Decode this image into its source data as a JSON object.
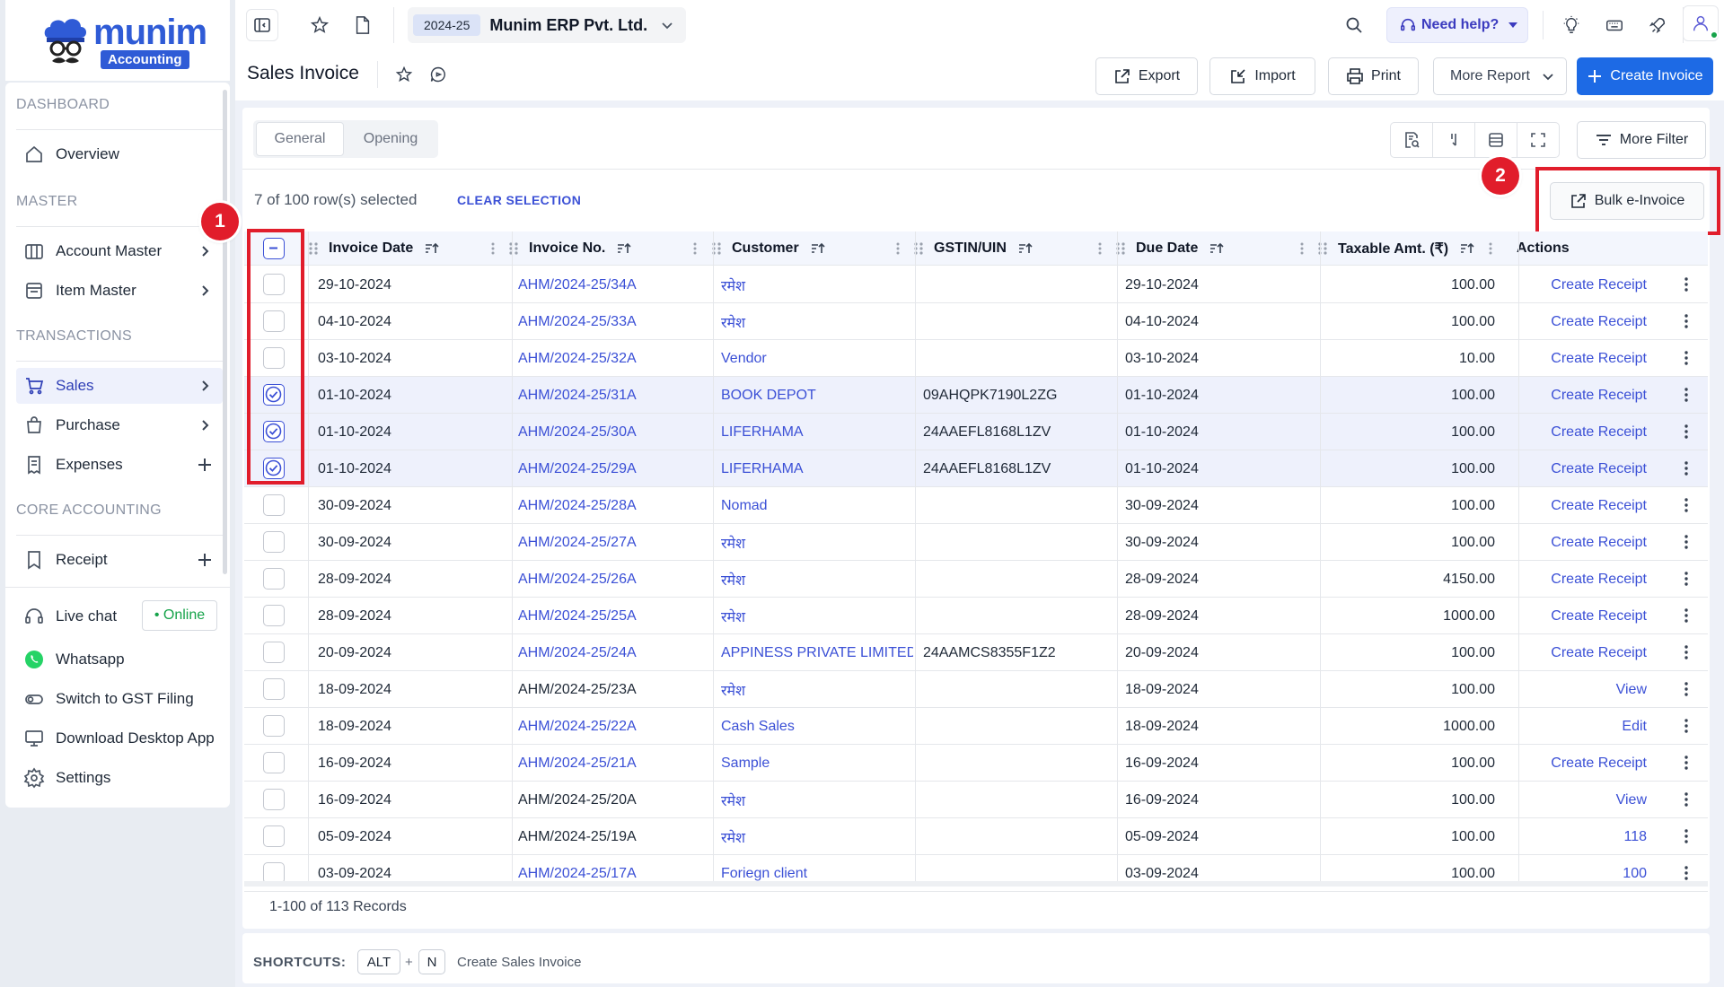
{
  "brand": {
    "name": "munim",
    "tag": "Accounting",
    "color": "#2f5bd6"
  },
  "colors": {
    "accent": "#1d6ae5",
    "link": "#3b50d6",
    "highlight": "#e11d2b",
    "online": "#16a34a"
  },
  "sidebar": {
    "sections": {
      "dashboard": "DASHBOARD",
      "master": "MASTER",
      "transactions": "TRANSACTIONS",
      "core": "CORE ACCOUNTING"
    },
    "items": {
      "overview": "Overview",
      "account_master": "Account Master",
      "item_master": "Item Master",
      "sales": "Sales",
      "purchase": "Purchase",
      "expenses": "Expenses",
      "receipt": "Receipt"
    },
    "bottom": {
      "live_chat": "Live chat",
      "online": "• Online",
      "whatsapp": "Whatsapp",
      "gst": "Switch to GST Filing",
      "download": "Download Desktop App",
      "settings": "Settings"
    }
  },
  "topbar": {
    "fy": "2024-25",
    "company": "Munim ERP Pvt. Ltd.",
    "help": "Need help?"
  },
  "header": {
    "title": "Sales Invoice",
    "export": "Export",
    "import": "Import",
    "print": "Print",
    "more_report": "More Report",
    "create": "Create Invoice"
  },
  "tabs": [
    "General",
    "Opening"
  ],
  "toolbar": {
    "more_filter": "More Filter",
    "bulk": "Bulk e-Invoice"
  },
  "selection": {
    "text": "7 of 100 row(s) selected",
    "clear": "CLEAR SELECTION"
  },
  "annotations": [
    "1",
    "2"
  ],
  "table": {
    "columns": [
      "Invoice Date",
      "Invoice No.",
      "Customer",
      "GSTIN/UIN",
      "Due Date",
      "Taxable Amt. (₹)",
      "Actions"
    ],
    "rows": [
      {
        "date": "29-10-2024",
        "no": "AHM/2024-25/34A",
        "no_link": true,
        "customer": "रमेश",
        "gstin": "",
        "due": "29-10-2024",
        "amt": "100.00",
        "action": "Create Receipt",
        "selected": false
      },
      {
        "date": "04-10-2024",
        "no": "AHM/2024-25/33A",
        "no_link": true,
        "customer": "रमेश",
        "gstin": "",
        "due": "04-10-2024",
        "amt": "100.00",
        "action": "Create Receipt",
        "selected": false
      },
      {
        "date": "03-10-2024",
        "no": "AHM/2024-25/32A",
        "no_link": true,
        "customer": "Vendor",
        "gstin": "",
        "due": "03-10-2024",
        "amt": "10.00",
        "action": "Create Receipt",
        "selected": false
      },
      {
        "date": "01-10-2024",
        "no": "AHM/2024-25/31A",
        "no_link": true,
        "customer": "BOOK DEPOT",
        "gstin": "09AHQPK7190L2ZG",
        "due": "01-10-2024",
        "amt": "100.00",
        "action": "Create Receipt",
        "selected": true
      },
      {
        "date": "01-10-2024",
        "no": "AHM/2024-25/30A",
        "no_link": true,
        "customer": "LIFERHAMA",
        "gstin": "24AAEFL8168L1ZV",
        "due": "01-10-2024",
        "amt": "100.00",
        "action": "Create Receipt",
        "selected": true
      },
      {
        "date": "01-10-2024",
        "no": "AHM/2024-25/29A",
        "no_link": true,
        "customer": "LIFERHAMA",
        "gstin": "24AAEFL8168L1ZV",
        "due": "01-10-2024",
        "amt": "100.00",
        "action": "Create Receipt",
        "selected": true
      },
      {
        "date": "30-09-2024",
        "no": "AHM/2024-25/28A",
        "no_link": true,
        "customer": "Nomad",
        "gstin": "",
        "due": "30-09-2024",
        "amt": "100.00",
        "action": "Create Receipt",
        "selected": false
      },
      {
        "date": "30-09-2024",
        "no": "AHM/2024-25/27A",
        "no_link": true,
        "customer": "रमेश",
        "gstin": "",
        "due": "30-09-2024",
        "amt": "100.00",
        "action": "Create Receipt",
        "selected": false
      },
      {
        "date": "28-09-2024",
        "no": "AHM/2024-25/26A",
        "no_link": true,
        "customer": "रमेश",
        "gstin": "",
        "due": "28-09-2024",
        "amt": "4150.00",
        "action": "Create Receipt",
        "selected": false
      },
      {
        "date": "28-09-2024",
        "no": "AHM/2024-25/25A",
        "no_link": true,
        "customer": "रमेश",
        "gstin": "",
        "due": "28-09-2024",
        "amt": "1000.00",
        "action": "Create Receipt",
        "selected": false
      },
      {
        "date": "20-09-2024",
        "no": "AHM/2024-25/24A",
        "no_link": true,
        "customer": "APPINESS PRIVATE LIMITED",
        "gstin": "24AAMCS8355F1Z2",
        "due": "20-09-2024",
        "amt": "100.00",
        "action": "Create Receipt",
        "selected": false
      },
      {
        "date": "18-09-2024",
        "no": "AHM/2024-25/23A",
        "no_link": false,
        "customer": "रमेश",
        "gstin": "",
        "due": "18-09-2024",
        "amt": "100.00",
        "action": "View",
        "selected": false
      },
      {
        "date": "18-09-2024",
        "no": "AHM/2024-25/22A",
        "no_link": true,
        "customer": "Cash Sales",
        "gstin": "",
        "due": "18-09-2024",
        "amt": "1000.00",
        "action": "Edit",
        "selected": false
      },
      {
        "date": "16-09-2024",
        "no": "AHM/2024-25/21A",
        "no_link": true,
        "customer": "Sample",
        "gstin": "",
        "due": "16-09-2024",
        "amt": "100.00",
        "action": "Create Receipt",
        "selected": false
      },
      {
        "date": "16-09-2024",
        "no": "AHM/2024-25/20A",
        "no_link": false,
        "customer": "रमेश",
        "gstin": "",
        "due": "16-09-2024",
        "amt": "100.00",
        "action": "View",
        "selected": false
      },
      {
        "date": "05-09-2024",
        "no": "AHM/2024-25/19A",
        "no_link": false,
        "customer": "रमेश",
        "gstin": "",
        "due": "05-09-2024",
        "amt": "100.00",
        "action": "118",
        "selected": false
      },
      {
        "date": "03-09-2024",
        "no": "AHM/2024-25/17A",
        "no_link": true,
        "customer": "Foriegn client",
        "gstin": "",
        "due": "03-09-2024",
        "amt": "100.00",
        "action": "100",
        "selected": false
      }
    ]
  },
  "footer": {
    "records": "1-100 of 113 Records"
  },
  "shortcuts": {
    "label": "SHORTCUTS:",
    "key1": "ALT",
    "plus": "+",
    "key2": "N",
    "desc": "Create Sales Invoice"
  }
}
